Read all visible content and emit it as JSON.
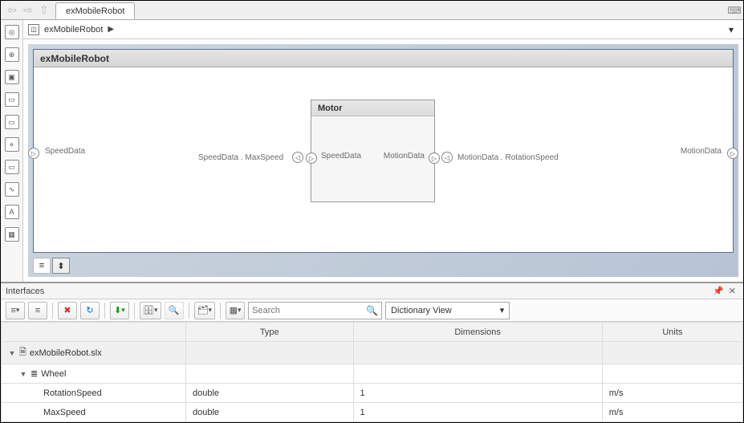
{
  "topbar": {
    "tab": "exMobileRobot"
  },
  "breadcrumb": {
    "label": "exMobileRobot"
  },
  "component": {
    "title": "exMobileRobot"
  },
  "ports": {
    "left_in": "SpeedData",
    "right_out": "MotionData",
    "bus_in": "SpeedData . MaxSpeed",
    "bus_out": "MotionData . RotationSpeed"
  },
  "motor": {
    "title": "Motor",
    "in": "SpeedData",
    "out": "MotionData"
  },
  "interfaces": {
    "title": "Interfaces",
    "search_placeholder": "Search",
    "view": "Dictionary View",
    "columns": {
      "c1": "",
      "c2": "Type",
      "c3": "Dimensions",
      "c4": "Units"
    },
    "rows": {
      "file": "exMobileRobot.slx",
      "struct": "Wheel",
      "r1": {
        "name": "RotationSpeed",
        "type": "double",
        "dim": "1",
        "units": "m/s"
      },
      "r2": {
        "name": "MaxSpeed",
        "type": "double",
        "dim": "1",
        "units": "m/s"
      }
    }
  }
}
